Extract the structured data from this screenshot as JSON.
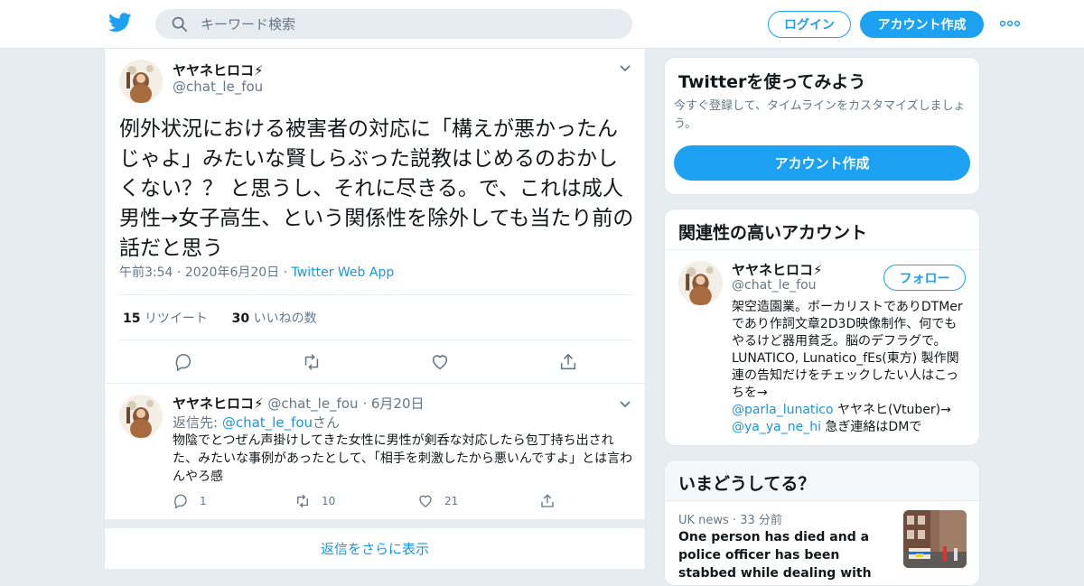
{
  "header": {
    "search_placeholder": "キーワード検索",
    "login_label": "ログイン",
    "signup_label": "アカウント作成",
    "brand_color": "#1da1f2",
    "icons": [
      "twitter-logo-icon",
      "search-icon",
      "more-icon"
    ]
  },
  "tweet": {
    "name": "ヤヤネヒロコ⚡",
    "handle": "@chat_le_fou",
    "text": "例外状況における被害者の対応に「構えが悪かったんじゃよ」みたいな賢しらぶった説教はじめるのおかしくない？？ と思うし、それに尽きる。で、これは成人男性→女子高生、という関係性を除外しても当たり前の話だと思う",
    "time": "午前3:54",
    "date": "2020年6月20日",
    "source": "Twitter Web App",
    "retweet_count": "15",
    "retweet_label": "リツイート",
    "like_count": "30",
    "like_label": "いいねの数",
    "action_icons": [
      "reply-icon",
      "retweet-icon",
      "like-icon",
      "share-icon"
    ]
  },
  "reply": {
    "name": "ヤヤネヒロコ⚡",
    "handle": "@chat_le_fou",
    "date": "6月20日",
    "reply_prefix": "返信先: ",
    "reply_to": "@chat_le_fou",
    "reply_suffix": "さん",
    "text": "物陰でとつぜん声掛けしてきた女性に男性が剣呑な対応したら包丁持ち出された、みたいな事例があったとして、「相手を刺激したから悪いんですよ」とは言わんやろ感",
    "reply_count": "1",
    "retweet_count": "10",
    "like_count": "21"
  },
  "show_more_label": "返信をさらに表示",
  "sidebar": {
    "try_card": {
      "title": "Twitterを使ってみよう",
      "desc": "今すぐ登録して、タイムラインをカスタマイズしましょう。",
      "button": "アカウント作成"
    },
    "related_card": {
      "title": "関連性の高いアカウント",
      "name": "ヤヤネヒロコ⚡",
      "handle": "@chat_le_fou",
      "follow_label": "フォロー",
      "bio_1": "架空造園業。ボーカリストでありDTMerであり作詞文章2D3D映像制作、何でもやるけど器用貧乏。脳のデフラグで。LUNATICO, Lunatico_fEs(東方) 製作関連の告知だけをチェックしたい人はこっちを→",
      "bio_link_1": "@parla_lunatico",
      "bio_2": " ヤヤネヒ(Vtuber)→",
      "bio_link_2": "@ya_ya_ne_hi",
      "bio_3": " 急ぎ連絡はDMで"
    },
    "trends_card": {
      "title": "いまどうしてる？",
      "news_source": "UK news",
      "news_time": "33 分前",
      "news_headline": "One person has died and a police officer has been stabbed while dealing with an incident in Glasgow"
    }
  }
}
